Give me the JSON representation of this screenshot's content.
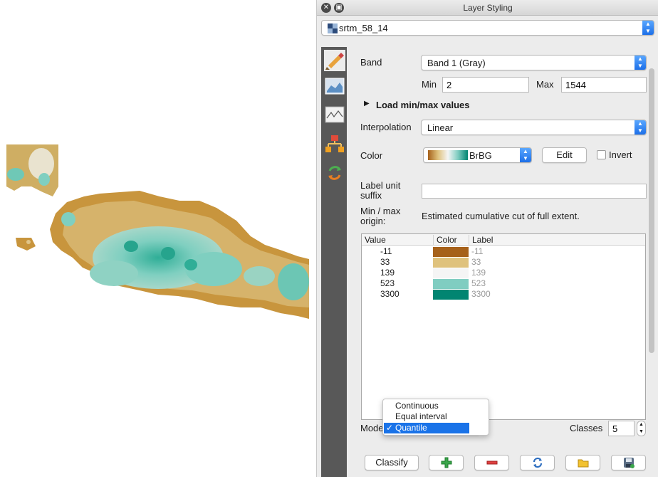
{
  "window": {
    "title": "Layer Styling"
  },
  "layer": {
    "name": "srtm_58_14"
  },
  "band": {
    "label": "Band",
    "value": "Band 1 (Gray)"
  },
  "minmax": {
    "min_label": "Min",
    "min_value": "2",
    "max_label": "Max",
    "max_value": "1544"
  },
  "load": {
    "label": "Load min/max values"
  },
  "interpolation": {
    "label": "Interpolation",
    "value": "Linear"
  },
  "color": {
    "label": "Color",
    "ramp": "BrBG",
    "edit_label": "Edit",
    "invert_label": "Invert",
    "ramp_colors": [
      "#a6611a",
      "#dfc27d",
      "#f5f5f5",
      "#80cdc1",
      "#018571"
    ]
  },
  "suffix": {
    "label": "Label unit suffix",
    "value": ""
  },
  "origin": {
    "label": "Min / max origin:",
    "value": "Estimated cumulative cut of full extent."
  },
  "table": {
    "headers": [
      "Value",
      "Color",
      "Label"
    ],
    "rows": [
      {
        "value": "-11",
        "color": "#a6611a",
        "label": "-11"
      },
      {
        "value": "33",
        "color": "#dfc27d",
        "label": "33"
      },
      {
        "value": "139",
        "color": "#f5f5f5",
        "label": "139"
      },
      {
        "value": "523",
        "color": "#80cdc1",
        "label": "523"
      },
      {
        "value": "3300",
        "color": "#018571",
        "label": "3300"
      }
    ]
  },
  "mode": {
    "label": "Mode",
    "options": [
      "Continuous",
      "Equal interval",
      "Quantile"
    ],
    "selected": "Quantile"
  },
  "classes": {
    "label": "Classes",
    "value": "5"
  },
  "buttons": {
    "classify": "Classify"
  },
  "icons": {
    "sidebar": [
      "brush-icon",
      "raster-histogram-icon",
      "line-histogram-icon",
      "layer-tree-icon",
      "refresh-icon"
    ],
    "bottom": [
      "add-icon",
      "remove-icon",
      "reload-icon",
      "folder-icon",
      "save-icon"
    ]
  }
}
